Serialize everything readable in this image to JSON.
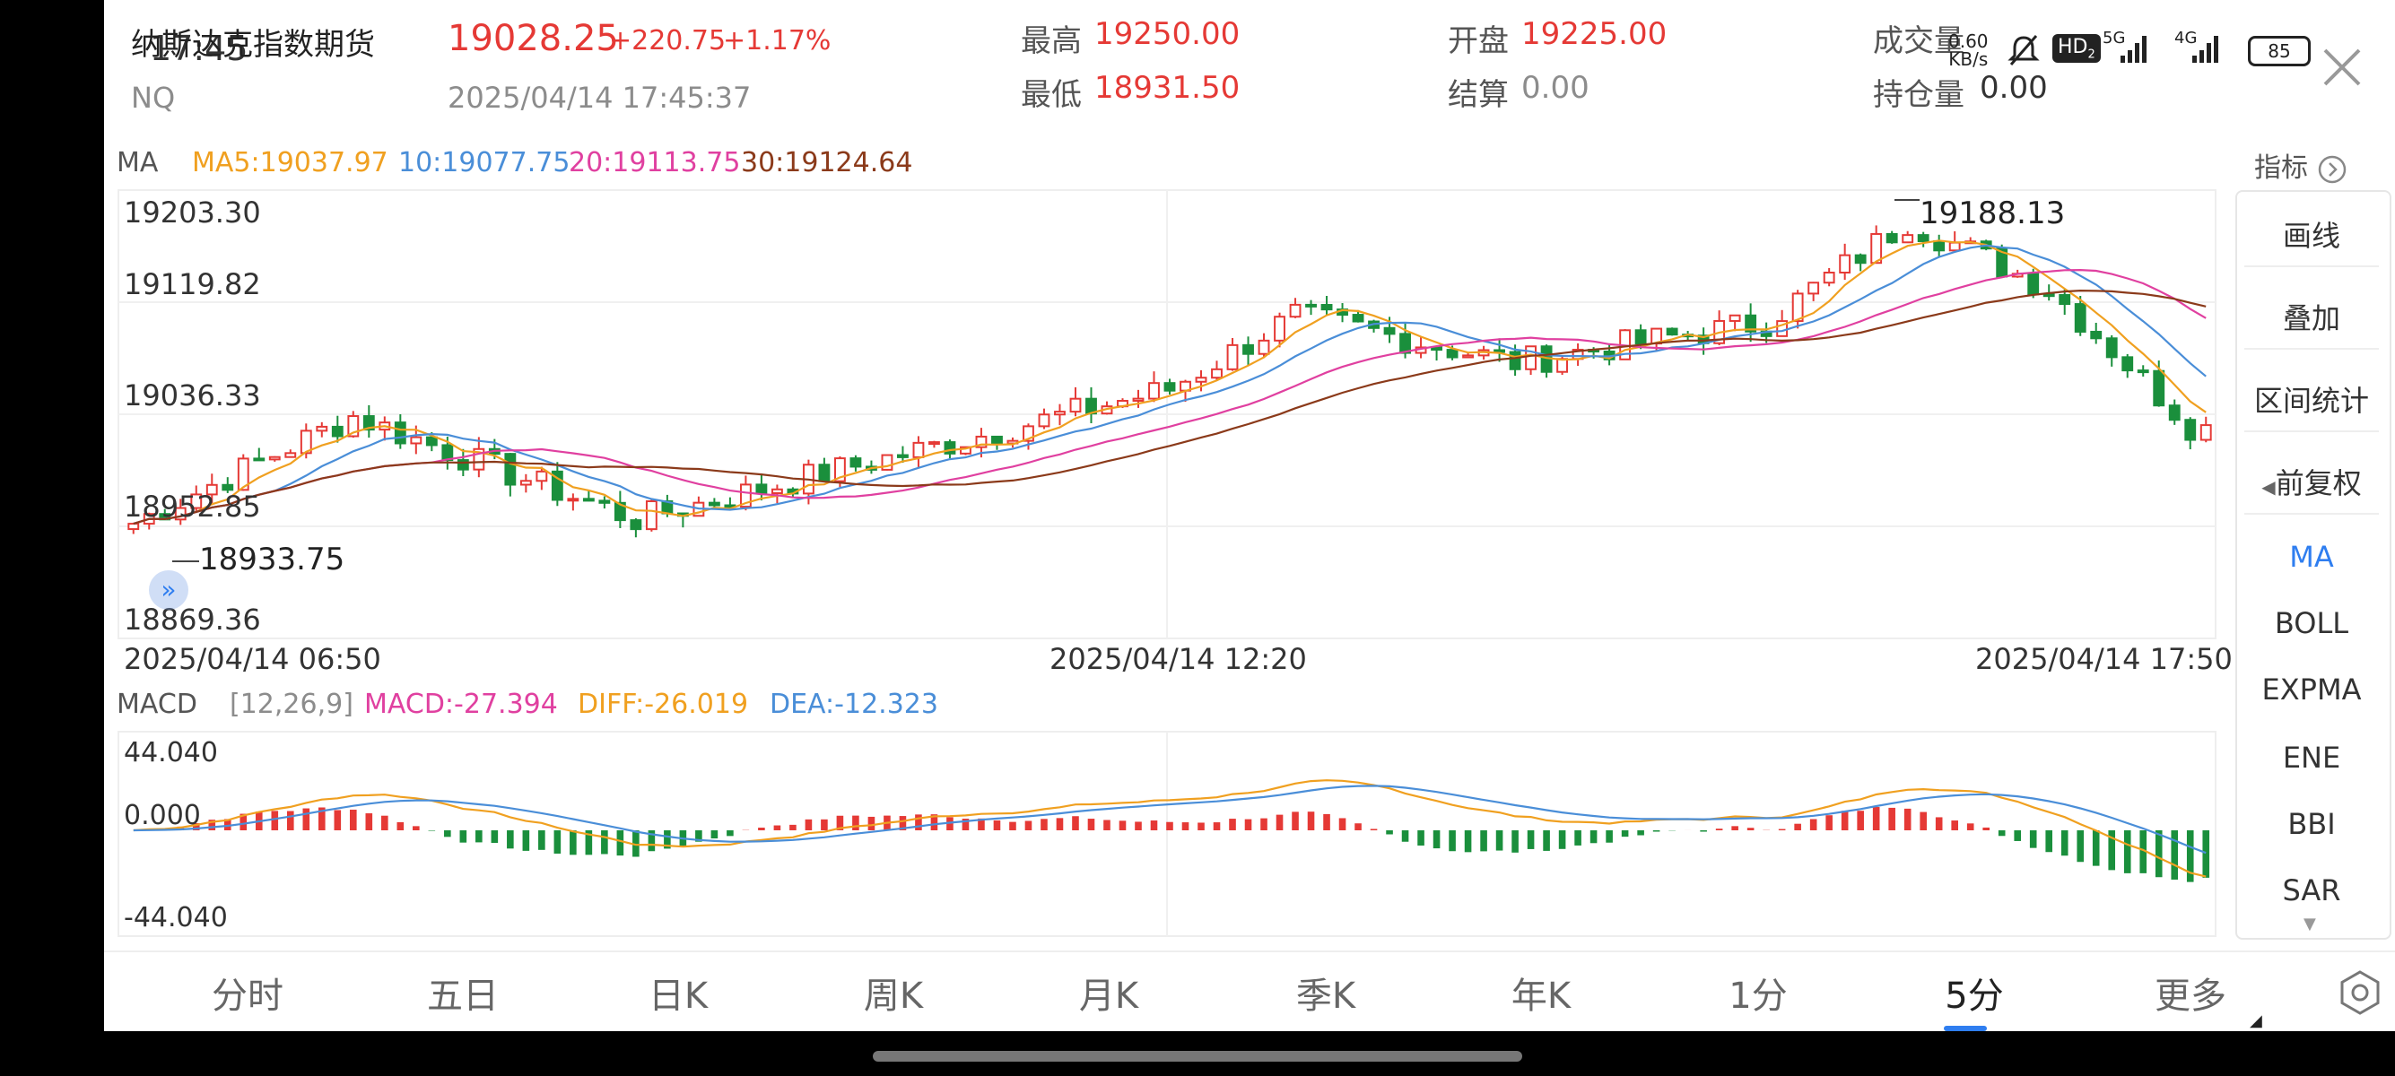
{
  "status_bar": {
    "time": "17:45",
    "net_speed_top": "0.60",
    "net_speed_bottom": "KB/s",
    "hd": "HD",
    "hd_sub": "2",
    "sig5g": "5G",
    "sig4g": "4G",
    "battery": "85"
  },
  "quote": {
    "name": "纳斯达克指数期货",
    "code": "NQ",
    "price": "19028.25",
    "change": "+220.75",
    "change_pct": "+1.17%",
    "datetime": "2025/04/14 17:45:37",
    "high_label": "最高",
    "high": "19250.00",
    "low_label": "最低",
    "low": "18931.50",
    "open_label": "开盘",
    "open": "19225.00",
    "settle_label": "结算",
    "settle": "0.00",
    "volume_label": "成交量",
    "oi_label": "持仓量",
    "oi": "0.00"
  },
  "ma_legend": {
    "title": "MA",
    "ma5": "MA5:19037.97",
    "ma10": "10:19077.75",
    "ma20": "20:19113.75",
    "ma30": "30:19124.64",
    "indicator_btn": "指标"
  },
  "price_axis": [
    "19203.30",
    "19119.82",
    "19036.33",
    "18952.85",
    "18869.36"
  ],
  "max_label": "19188.13",
  "min_label": "18933.75",
  "time_axis": [
    "2025/04/14 06:50",
    "2025/04/14 12:20",
    "2025/04/14 17:50"
  ],
  "macd_legend": {
    "title": "MACD",
    "params": "[12,26,9]",
    "macd": "MACD:-27.394",
    "diff": "DIFF:-26.019",
    "dea": "DEA:-12.323"
  },
  "macd_axis": [
    "44.040",
    "0.000",
    "-44.040"
  ],
  "side_panel": {
    "tools": [
      "画线",
      "叠加",
      "区间统计",
      "前复权"
    ],
    "indicators": [
      "MA",
      "BOLL",
      "EXPMA",
      "ENE",
      "BBI",
      "SAR"
    ],
    "active_indicator": "MA"
  },
  "tabs": [
    "分时",
    "五日",
    "日K",
    "周K",
    "月K",
    "季K",
    "年K",
    "1分",
    "5分",
    "更多"
  ],
  "active_tab": "5分",
  "colors": {
    "up": "#e53935",
    "down": "#1a8f3c",
    "ma5": "#f0a020",
    "ma10": "#4a8ed8",
    "ma20": "#e040a0",
    "ma30": "#8b3a1a",
    "accent": "#2f7ef0"
  },
  "chart_data": {
    "type": "candlestick",
    "interval": "5分",
    "x_range": [
      "2025/04/14 06:50",
      "2025/04/14 17:50"
    ],
    "ylim": [
      18869.36,
      19203.3
    ],
    "n_candles": 133,
    "ohlc_key_points": [
      {
        "time": "06:50",
        "close": 18955
      },
      {
        "time": "08:00",
        "close": 19035
      },
      {
        "time": "09:30",
        "close": 18958
      },
      {
        "time": "12:20",
        "close": 19055
      },
      {
        "time": "13:00",
        "close": 19110
      },
      {
        "time": "14:10",
        "close": 19075
      },
      {
        "time": "15:30",
        "close": 19105
      },
      {
        "time": "16:15",
        "close": 19180
      },
      {
        "time": "17:00",
        "close": 19130
      },
      {
        "time": "17:45",
        "close": 19028.25
      }
    ],
    "macd_ylim": [
      -44.04,
      44.04
    ]
  }
}
